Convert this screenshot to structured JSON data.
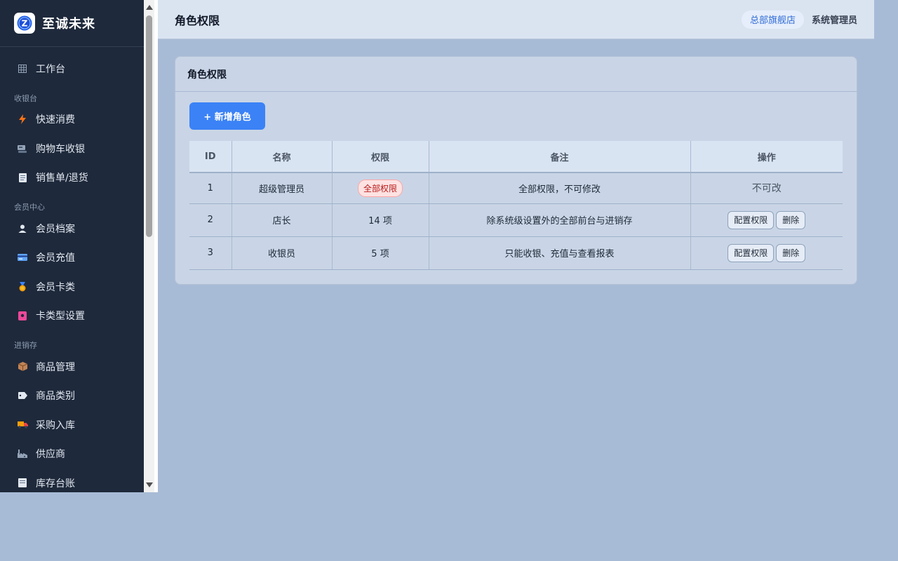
{
  "brand": {
    "name": "至诚未来",
    "logo_letter": "Z"
  },
  "sidebar": {
    "top_items": [
      {
        "label": "工作台",
        "icon": "grid-icon"
      }
    ],
    "sections": [
      {
        "title": "收银台",
        "items": [
          {
            "label": "快速消费",
            "icon": "lightning-icon"
          },
          {
            "label": "购物车收银",
            "icon": "cash-register-icon"
          },
          {
            "label": "销售单/退货",
            "icon": "receipt-icon"
          }
        ]
      },
      {
        "title": "会员中心",
        "items": [
          {
            "label": "会员档案",
            "icon": "user-icon"
          },
          {
            "label": "会员充值",
            "icon": "credit-card-icon"
          },
          {
            "label": "会员卡类",
            "icon": "medal-icon"
          },
          {
            "label": "卡类型设置",
            "icon": "card-settings-icon"
          }
        ]
      },
      {
        "title": "进销存",
        "items": [
          {
            "label": "商品管理",
            "icon": "package-icon"
          },
          {
            "label": "商品类别",
            "icon": "tag-icon"
          },
          {
            "label": "采购入库",
            "icon": "truck-icon"
          },
          {
            "label": "供应商",
            "icon": "factory-icon"
          },
          {
            "label": "库存台账",
            "icon": "ledger-icon"
          }
        ]
      }
    ]
  },
  "header": {
    "title": "角色权限",
    "store": "总部旗舰店",
    "user": "系统管理员"
  },
  "card": {
    "title": "角色权限",
    "add_button": "+ 新增角色"
  },
  "table": {
    "columns": [
      "ID",
      "名称",
      "权限",
      "备注",
      "操作"
    ],
    "rows": [
      {
        "id": "1",
        "name": "超级管理员",
        "perm": "全部权限",
        "note": "全部权限，不可修改",
        "action": "不可改"
      },
      {
        "id": "2",
        "name": "店长",
        "perm": "14 项",
        "note": "除系统级设置外的全部前台与进销存",
        "config_btn": "配置权限",
        "delete_btn": "删除"
      },
      {
        "id": "3",
        "name": "收银员",
        "perm": "5 项",
        "note": "只能收银、充值与查看报表",
        "config_btn": "配置权限",
        "delete_btn": "删除"
      }
    ]
  },
  "colors": {
    "sidebar_bg": "#1e293b",
    "primary": "#3b82f6",
    "page_bg": "#a8bbd6",
    "danger_tag": "#b91c1c"
  }
}
